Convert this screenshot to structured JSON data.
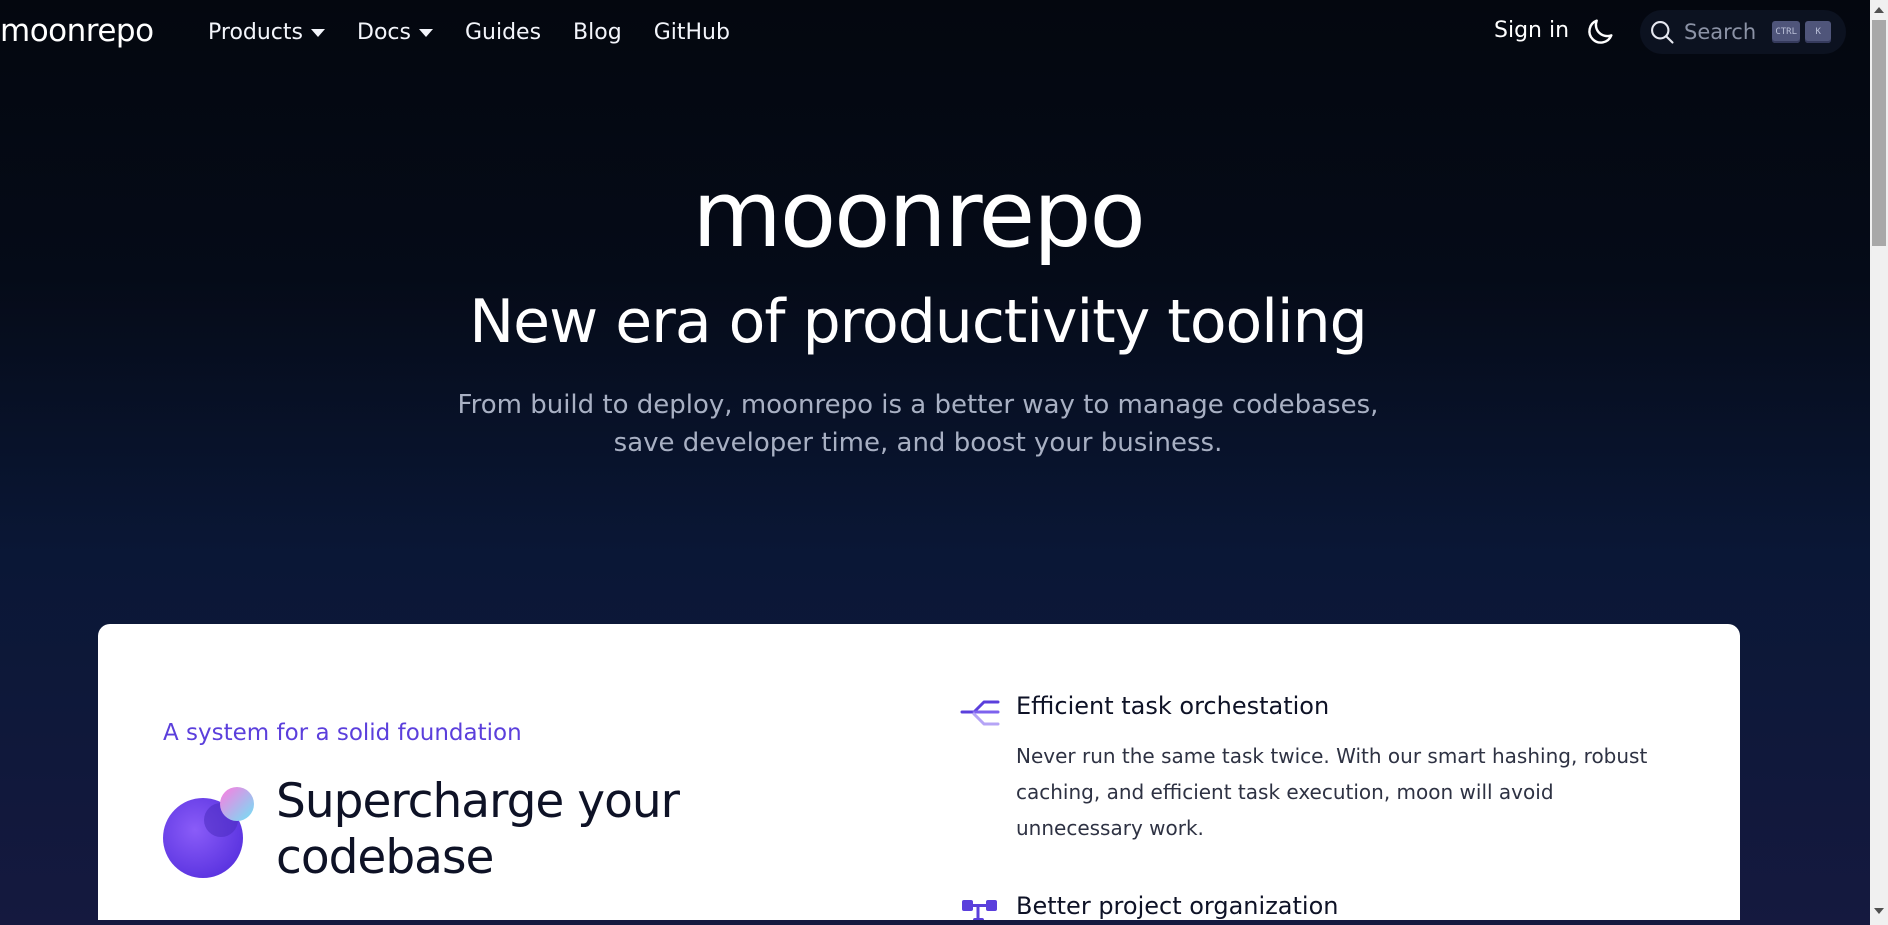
{
  "nav": {
    "logo": "moonrepo",
    "links": [
      {
        "label": "Products",
        "dropdown": true
      },
      {
        "label": "Docs",
        "dropdown": true
      },
      {
        "label": "Guides",
        "dropdown": false
      },
      {
        "label": "Blog",
        "dropdown": false
      },
      {
        "label": "GitHub",
        "dropdown": false
      }
    ],
    "signin": "Sign in",
    "theme_toggle_icon": "moon-icon",
    "search": {
      "label": "Search",
      "shortcut_ctrl": "CTRL",
      "shortcut_key": "K"
    }
  },
  "hero": {
    "logo": "moonrepo",
    "title": "New era of productivity tooling",
    "subtitle_line1": "From build to deploy, moonrepo is a better way to manage codebases,",
    "subtitle_line2": "save developer time, and boost your business."
  },
  "card": {
    "eyebrow": "A system for a solid foundation",
    "title_line1": "Supercharge your",
    "title_line2": "codebase",
    "features": [
      {
        "icon": "task-orchestration-icon",
        "title": "Efficient task orchestation",
        "description": "Never run the same task twice. With our smart hashing, robust caching, and efficient task execution, moon will avoid unnecessary work."
      },
      {
        "icon": "project-organization-icon",
        "title": "Better project organization",
        "description": ""
      }
    ]
  },
  "colors": {
    "accent": "#5b3fdc",
    "background_top": "#04070f",
    "background_bottom": "#15193f",
    "card_bg": "#ffffff"
  }
}
